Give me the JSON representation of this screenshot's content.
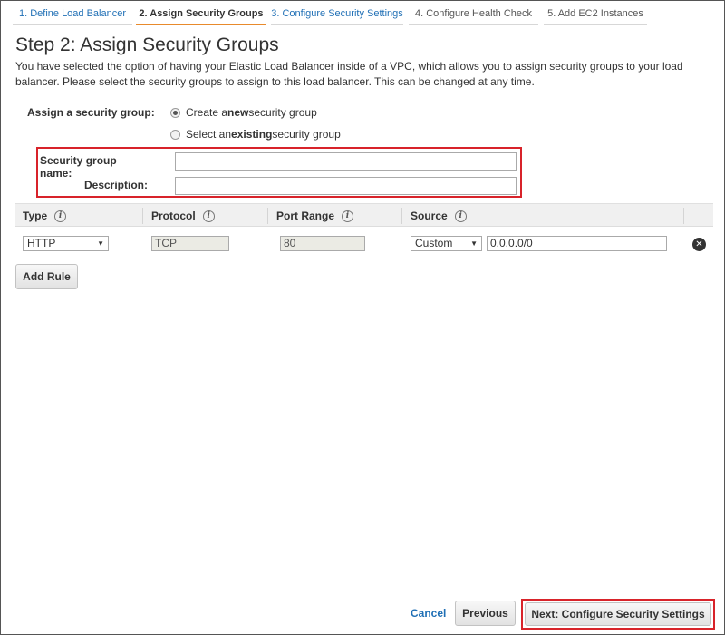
{
  "tabs": [
    {
      "label": "1. Define Load Balancer"
    },
    {
      "label": "2. Assign Security Groups"
    },
    {
      "label": "3. Configure Security Settings"
    },
    {
      "label": "4. Configure Health Check"
    },
    {
      "label": "5. Add EC2 Instances"
    }
  ],
  "page": {
    "title": "Step 2: Assign Security Groups",
    "description": "You have selected the option of having your Elastic Load Balancer inside of a VPC, which allows you to assign security groups to your load balancer. Please select the security groups to assign to this load balancer. This can be changed at any time."
  },
  "assign": {
    "label": "Assign a security group:",
    "option_new": {
      "prefix": "Create a ",
      "bold": "new",
      "suffix": " security group",
      "selected": true
    },
    "option_existing": {
      "prefix": "Select an ",
      "bold": "existing",
      "suffix": " security group",
      "selected": false
    }
  },
  "form": {
    "name_label": "Security group name:",
    "name_value": "",
    "description_label": "Description:",
    "description_value": ""
  },
  "table": {
    "headers": {
      "type": "Type",
      "protocol": "Protocol",
      "port_range": "Port Range",
      "source": "Source"
    },
    "rows": [
      {
        "type": "HTTP",
        "protocol": "TCP",
        "port_range": "80",
        "source_type": "Custom",
        "source_value": "0.0.0.0/0"
      }
    ]
  },
  "buttons": {
    "add_rule": "Add Rule",
    "cancel": "Cancel",
    "previous": "Previous",
    "next": "Next: Configure Security Settings"
  },
  "icons": {
    "info": "info-icon",
    "remove": "remove-circle-icon",
    "caret": "caret-down-icon"
  },
  "colors": {
    "link": "#1f6fb5",
    "active_tab_underline": "#e88a2c",
    "highlight": "#d8232a"
  }
}
